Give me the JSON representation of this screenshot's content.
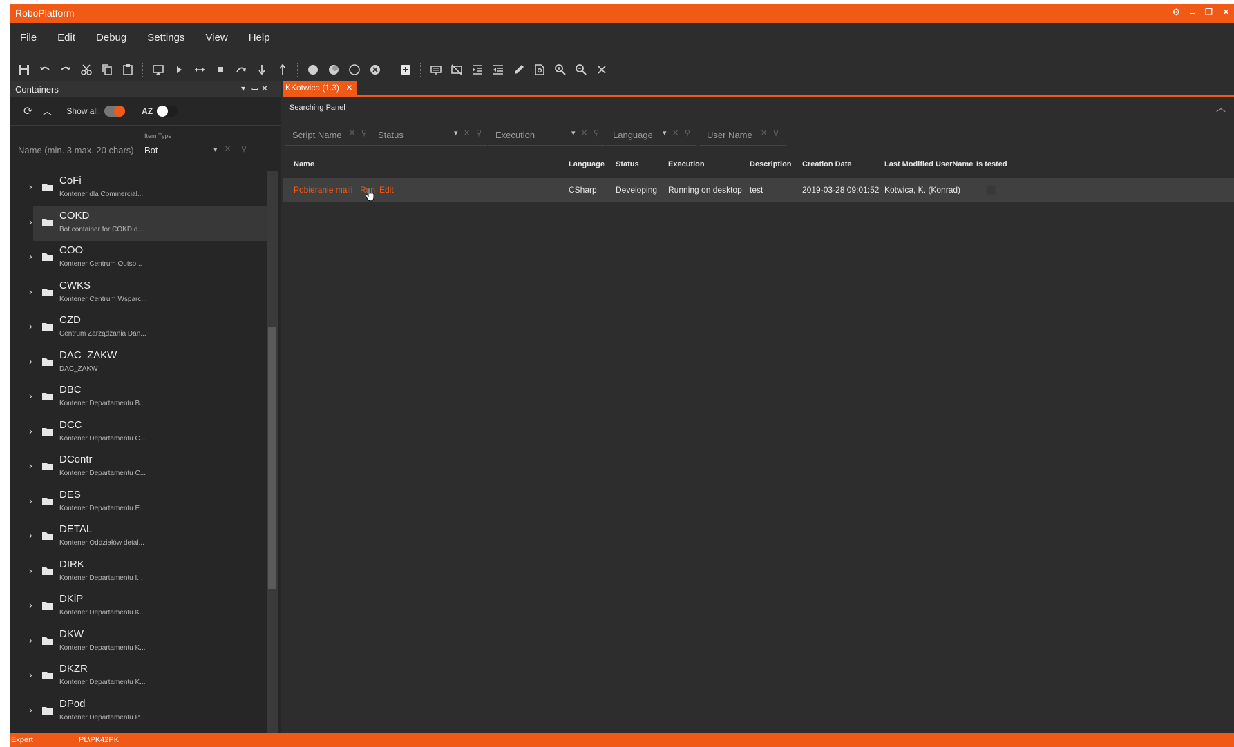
{
  "window": {
    "title": "RoboPlatform"
  },
  "menu": [
    "File",
    "Edit",
    "Debug",
    "Settings",
    "View",
    "Help"
  ],
  "toolbar_icons": [
    "save-icon",
    "undo-icon",
    "redo-icon",
    "cut-icon",
    "copy-icon",
    "paste-icon",
    "screen-icon",
    "play-icon",
    "step-icon",
    "stop-icon",
    "step-over-icon",
    "step-into-icon",
    "step-out-icon",
    "circle-filled-icon",
    "circle-half-icon",
    "circle-empty-icon",
    "circle-x-icon",
    "add-box-icon",
    "keyboard-icon",
    "no-keyboard-icon",
    "indent-icon",
    "outdent-icon",
    "pen-icon",
    "find-file-icon",
    "zoom-in-icon",
    "zoom-out-icon",
    "close-icon"
  ],
  "left_panel": {
    "title": "Containers",
    "show_all_label": "Show all:",
    "sort_label": "AZ",
    "show_all_on": true,
    "sort_on": false,
    "name_placeholder": "Name (min. 3 max. 20 chars)",
    "item_type_label": "Item Type",
    "item_type_value": "Bot",
    "tree": [
      {
        "name": "CoFi",
        "desc": "Kontener dla Commercial..."
      },
      {
        "name": "COKD",
        "desc": "Bot container for COKD d...",
        "selected": true
      },
      {
        "name": "COO",
        "desc": "Kontener Centrum Outso..."
      },
      {
        "name": "CWKS",
        "desc": "Kontener Centrum Wsparc..."
      },
      {
        "name": "CZD",
        "desc": "Centrum Zarządzania Dan..."
      },
      {
        "name": "DAC_ZAKW",
        "desc": "DAC_ZAKW"
      },
      {
        "name": "DBC",
        "desc": "Kontener Departamentu B..."
      },
      {
        "name": "DCC",
        "desc": "Kontener Departamentu C..."
      },
      {
        "name": "DContr",
        "desc": "Kontener Departamentu C..."
      },
      {
        "name": "DES",
        "desc": "Kontener Departamentu E..."
      },
      {
        "name": "DETAL",
        "desc": "Kontener Oddziałów detal..."
      },
      {
        "name": "DIRK",
        "desc": "Kontener Departamentu I..."
      },
      {
        "name": "DKiP",
        "desc": "Kontener Departamentu K..."
      },
      {
        "name": "DKW",
        "desc": "Kontener Departamentu K..."
      },
      {
        "name": "DKZR",
        "desc": "Kontener Departamentu K..."
      },
      {
        "name": "DPod",
        "desc": "Kontener Departamentu P..."
      }
    ]
  },
  "tab": {
    "label": "KKotwica (1.3)"
  },
  "searching_panel": {
    "title": "Searching Panel"
  },
  "filters": [
    "Script Name",
    "Status",
    "Execution",
    "Language",
    "User Name"
  ],
  "grid": {
    "headers": [
      "Name",
      "Language",
      "Status",
      "Execution",
      "Description",
      "Creation Date",
      "Last Modified UserName",
      "Is tested"
    ],
    "rows": [
      {
        "name": "Pobieranie maili",
        "run": "Run",
        "edit": "Edit",
        "language": "CSharp",
        "status": "Developing",
        "execution": "Running on desktop",
        "description": "test",
        "creation_date": "2019-03-28 09:01:52",
        "user": "Kotwica, K. (Konrad)",
        "is_tested": false
      }
    ]
  },
  "statusbar": {
    "mode": "Expert",
    "machine": "PL\\PK42PK"
  },
  "colors": {
    "accent": "#f15a16",
    "bg": "#2d2d2d",
    "panel": "#262626"
  }
}
